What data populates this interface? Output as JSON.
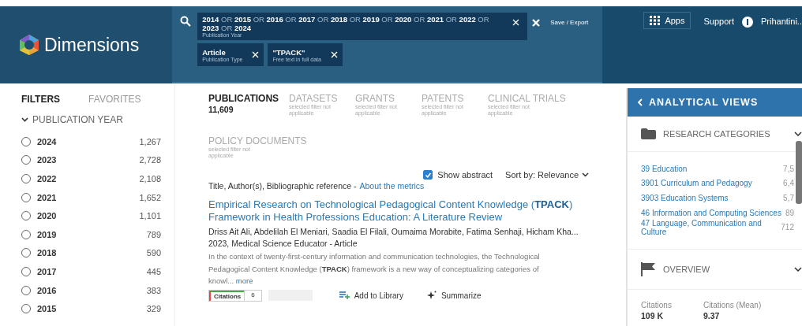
{
  "header": {
    "logo": "Dimensions",
    "query": {
      "text": "**2014** OR **2015** OR **2016** OR **2017** OR **2018** OR **2019** OR **2020** OR **2021** OR **2022** OR **2023** OR **2024**",
      "sublabel": "Publication Year"
    },
    "chips": [
      {
        "label": "Article",
        "sublabel": "Publication Type"
      },
      {
        "label": "\"TPACK\"",
        "sublabel": "Free text in full data"
      }
    ],
    "save_export": "Save / Export",
    "nav": {
      "apps": "Apps",
      "support": "Support",
      "user": "Prihantini.."
    }
  },
  "sidebar": {
    "tabs": [
      {
        "label": "FILTERS",
        "selected": true
      },
      {
        "label": "FAVORITES",
        "selected": false
      }
    ],
    "facet": {
      "title": "PUBLICATION YEAR",
      "expanded": true
    },
    "years": [
      {
        "label": "2024",
        "count": "1,267",
        "checked": false
      },
      {
        "label": "2023",
        "count": "2,728",
        "checked": false
      },
      {
        "label": "2022",
        "count": "2,108",
        "checked": false
      },
      {
        "label": "2021",
        "count": "1,652",
        "checked": false
      },
      {
        "label": "2020",
        "count": "1,101",
        "checked": false
      },
      {
        "label": "2019",
        "count": "789",
        "checked": false
      },
      {
        "label": "2018",
        "count": "590",
        "checked": false
      },
      {
        "label": "2017",
        "count": "445",
        "checked": false
      },
      {
        "label": "2016",
        "count": "383",
        "checked": false
      },
      {
        "label": "2015",
        "count": "329",
        "checked": false
      }
    ]
  },
  "main": {
    "tabs": [
      {
        "label": "PUBLICATIONS",
        "note": "11,609",
        "selected": true
      },
      {
        "label": "DATASETS",
        "note": "selected filter not applicable",
        "selected": false
      },
      {
        "label": "GRANTS",
        "note": "selected filter not applicable",
        "selected": false
      },
      {
        "label": "PATENTS",
        "note": "selected filter not applicable",
        "selected": false
      },
      {
        "label": "CLINICAL TRIALS",
        "note": "selected filter not applicable",
        "selected": false
      },
      {
        "label": "POLICY DOCUMENTS",
        "note": "selected filter not applicable",
        "selected": false
      }
    ],
    "show_abstract": {
      "label": "Show abstract",
      "checked": true
    },
    "sort": {
      "label": "Sort by:",
      "value": "Relevance"
    },
    "legend": "Title, Author(s), Bibliographic reference -",
    "metrics_link": "About the metrics",
    "result": {
      "title": "Empirical Research on Technological Pedagogical Content Knowledge (**TPACK**) Framework in Health Professions Education: A Literature Review",
      "authors": "Driss Ait Ali, Abdelilah El Meniari, Saadia El Filali, Oumaima Morabite, Fatima Senhaji, Hicham Kha...",
      "meta": "2023, Medical Science Educator - Article",
      "abstract": "In the context of twenty-first-century information and communication technologies, the Technological Pedagogical Content Knowledge (**TPACK**) framework is a new way of conceptualizing categories of knowl...",
      "more": "more",
      "citations_label": "Citations",
      "citations": "6",
      "add_library": "Add to Library",
      "summarize": "Summarize"
    }
  },
  "panel": {
    "title": "ANALYTICAL VIEWS",
    "categories_title": "RESEARCH CATEGORIES",
    "categories": [
      {
        "label": "39 Education",
        "count": "7,5"
      },
      {
        "label": "3901 Curriculum and Pedagogy",
        "count": "6,4"
      },
      {
        "label": "3903 Education Systems",
        "count": "5,7"
      },
      {
        "label": "46 Information and Computing Sciences",
        "count": "89"
      },
      {
        "label": "47 Language, Communication and Culture",
        "count": "712"
      }
    ],
    "overview_title": "OVERVIEW",
    "metrics": [
      {
        "label": "Citations",
        "value": "109 K"
      },
      {
        "label": "Citations (Mean)",
        "value": "9.37"
      }
    ]
  }
}
